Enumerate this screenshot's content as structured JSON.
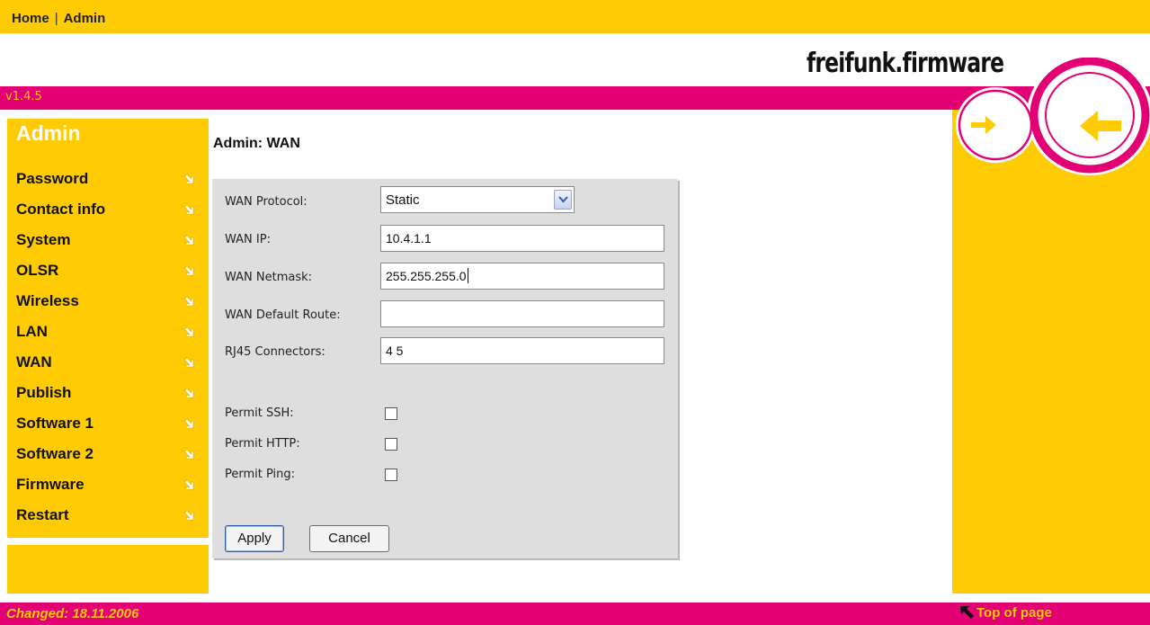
{
  "topnav": {
    "home": "Home",
    "separator": "|",
    "admin": "Admin"
  },
  "brand": "freifunk.firmware",
  "version": "v1.4.5",
  "sidebar": {
    "title": "Admin",
    "items": [
      {
        "label": "Password"
      },
      {
        "label": "Contact info"
      },
      {
        "label": "System"
      },
      {
        "label": "OLSR"
      },
      {
        "label": "Wireless"
      },
      {
        "label": "LAN"
      },
      {
        "label": "WAN"
      },
      {
        "label": "Publish"
      },
      {
        "label": "Software 1"
      },
      {
        "label": "Software 2"
      },
      {
        "label": "Firmware"
      },
      {
        "label": "Restart"
      }
    ],
    "item_icon": "arrow-down-right-icon"
  },
  "page": {
    "title": "Admin: WAN"
  },
  "form": {
    "wan_protocol": {
      "label": "WAN Protocol:",
      "value": "Static"
    },
    "wan_ip": {
      "label": "WAN IP:",
      "value": "10.4.1.1"
    },
    "wan_netmask": {
      "label": "WAN Netmask:",
      "value": "255.255.255.0"
    },
    "wan_default_route": {
      "label": "WAN Default Route:",
      "value": ""
    },
    "rj45_connectors": {
      "label": "RJ45 Connectors:",
      "value": "4 5"
    },
    "permit_ssh": {
      "label": "Permit SSH:",
      "checked": false
    },
    "permit_http": {
      "label": "Permit HTTP:",
      "checked": false
    },
    "permit_ping": {
      "label": "Permit Ping:",
      "checked": false
    },
    "apply_label": "Apply",
    "cancel_label": "Cancel"
  },
  "footer": {
    "changed": "Changed: 18.11.2006",
    "top_of_page": "Top of page"
  },
  "colors": {
    "yellow": "#FFCB05",
    "magenta": "#E30074",
    "panel": "#DEDEDE"
  }
}
